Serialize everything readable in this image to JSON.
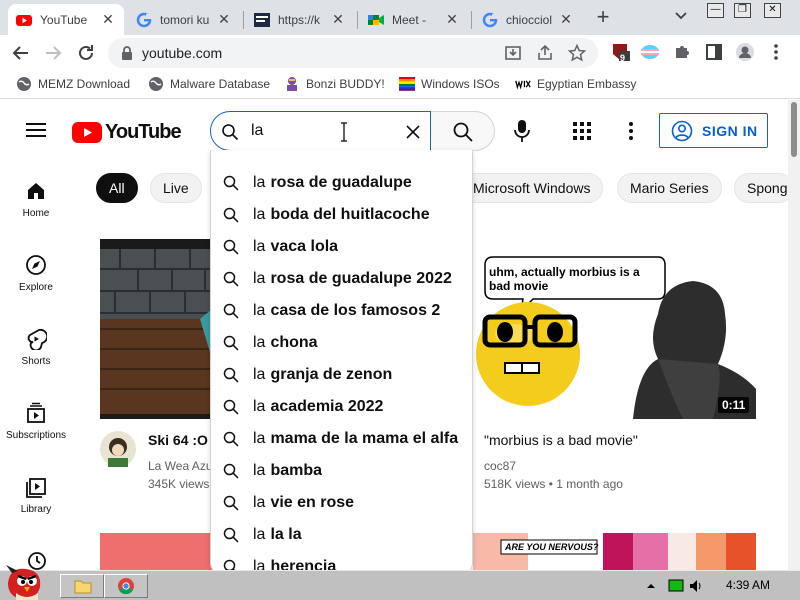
{
  "browser": {
    "tabs": [
      {
        "title": "YouTube",
        "favicon": "youtube-icon",
        "active": true
      },
      {
        "title": "tomori ku",
        "favicon": "google-icon",
        "active": false
      },
      {
        "title": "https://k",
        "favicon": "site-icon",
        "active": false
      },
      {
        "title": "Meet - ",
        "favicon": "meet-icon",
        "active": false
      },
      {
        "title": "chiocciol",
        "favicon": "google-icon",
        "active": false
      }
    ],
    "close_glyph": "✕",
    "new_tab_glyph": "+",
    "url": "youtube.com",
    "extension_badge": "9",
    "restore_glyph": "❐",
    "close_window_glyph": "✕",
    "minimize_glyph": "—"
  },
  "bookmarks": [
    {
      "label": "MEMZ Download",
      "icon": "globe-icon"
    },
    {
      "label": "Malware Database",
      "icon": "globe-icon"
    },
    {
      "label": "Bonzi BUDDY!",
      "icon": "bonzi-icon"
    },
    {
      "label": "Windows ISOs",
      "icon": "windows-flag-icon"
    },
    {
      "label": "Egyptian Embassy",
      "icon": "wix-icon"
    }
  ],
  "youtube": {
    "logo_text": "YouTube",
    "search_query": "la",
    "sign_in_label": "SIGN IN",
    "sidebar": [
      {
        "label": "Home",
        "icon": "home-icon"
      },
      {
        "label": "Explore",
        "icon": "compass-icon"
      },
      {
        "label": "Shorts",
        "icon": "shorts-icon"
      },
      {
        "label": "Subscriptions",
        "icon": "subscriptions-icon"
      },
      {
        "label": "Library",
        "icon": "library-icon"
      }
    ],
    "chips": [
      "All",
      "Live",
      "Microsoft Windows",
      "Mario Series",
      "Spong"
    ],
    "suggestions": [
      "rosa de guadalupe",
      "boda del huitlacoche",
      "vaca lola",
      "rosa de guadalupe 2022",
      "casa de los famosos 2",
      "chona",
      "granja de zenon",
      "academia 2022",
      "mama de la mama el alfa",
      "bamba",
      "vie en rose",
      "la la",
      "herencia"
    ],
    "videos": [
      {
        "title": "Ski 64 :O",
        "channel": "La Wea Azu",
        "meta": "345K views",
        "duration": ""
      },
      {
        "title": "\"morbius is a bad movie\"",
        "channel": "coc87",
        "meta": "518K views • 1 month ago",
        "duration": "0:11"
      }
    ],
    "meme_bubble": "uhm, actually morbius is a bad movie",
    "comic_caption": "ARE YOU NERVOUS?"
  },
  "taskbar": {
    "clock": "4:39 AM"
  },
  "colors": {
    "youtube_red": "#ff0000",
    "link_blue": "#065fd4",
    "taskbar_gray": "#c0c0c0"
  }
}
